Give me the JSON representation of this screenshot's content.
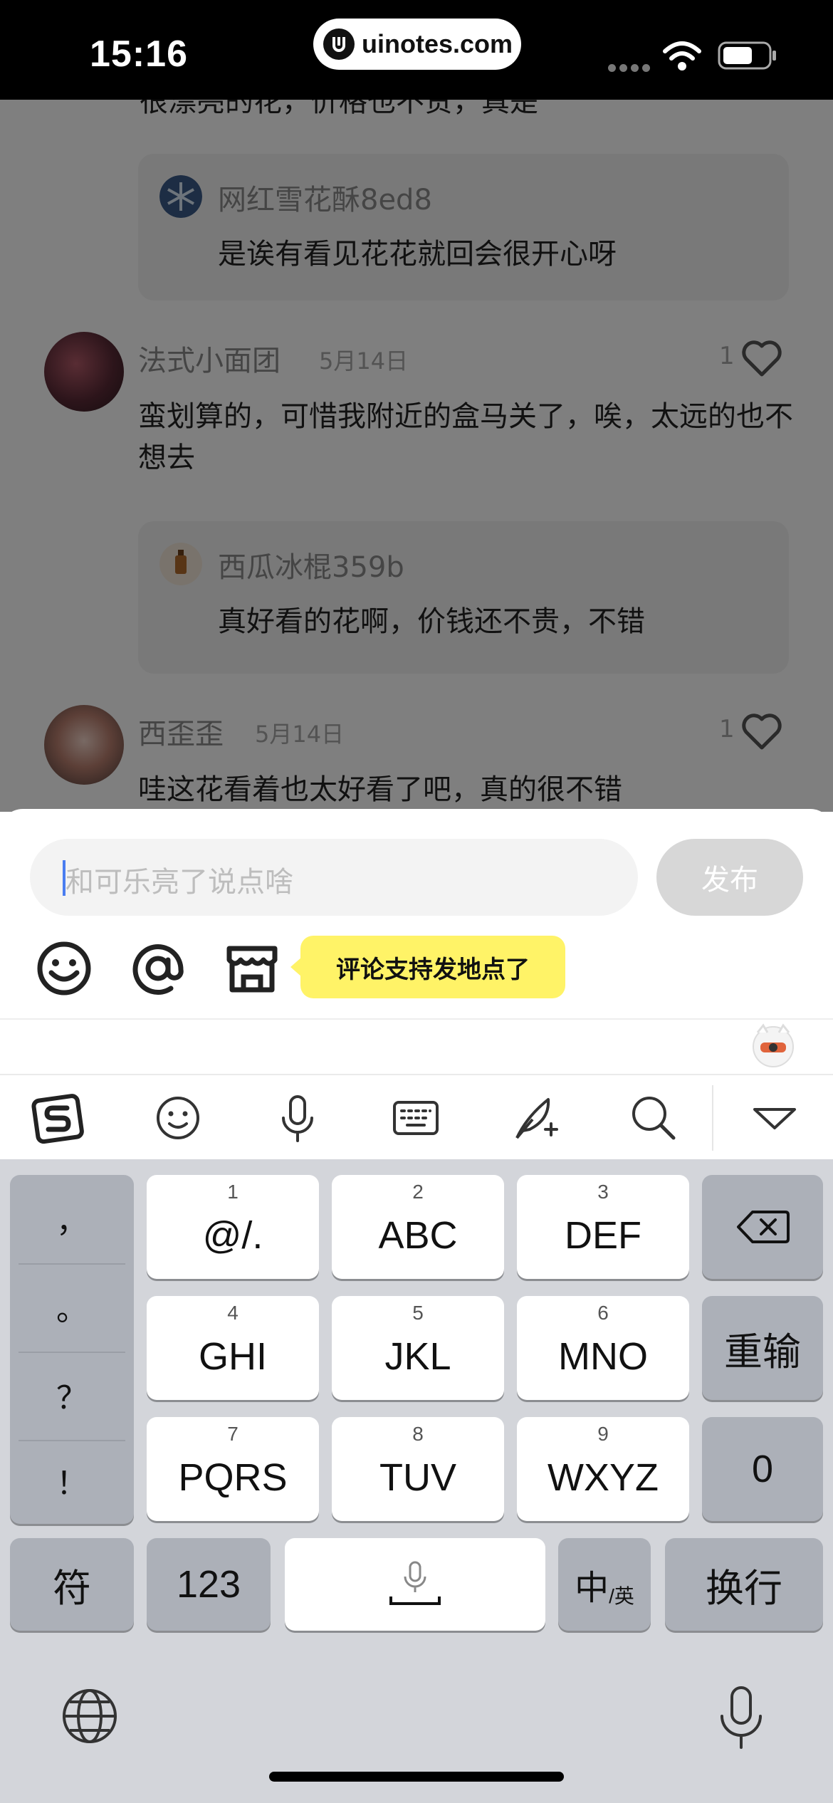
{
  "status_bar": {
    "time": "15:16",
    "url": "uinotes.com"
  },
  "feed": {
    "partial_top_text": "很漂亮的花，价格也不贵，真是",
    "replies": [
      {
        "user": "网红雪花酥8ed8",
        "text": "是诶有看见花花就回会很开心呀"
      },
      {
        "user": "西瓜冰棍359b",
        "text": "真好看的花啊，价钱还不贵，不错"
      }
    ],
    "comments": [
      {
        "user": "法式小面团",
        "date": "5月14日",
        "likes": "1",
        "text": "蛮划算的，可惜我附近的盒马关了，唉，太远的也不想去"
      },
      {
        "user": "西歪歪",
        "date": "5月14日",
        "likes": "1",
        "text": "哇这花看着也太好看了吧，真的很不错"
      }
    ]
  },
  "composer": {
    "placeholder": "和可乐亮了说点啥",
    "publish_label": "发布",
    "tooltip": "评论支持发地点了"
  },
  "keyboard": {
    "punctuation": [
      "，",
      "。",
      "？",
      "！"
    ],
    "keys": [
      {
        "num": "1",
        "label": "@/."
      },
      {
        "num": "2",
        "label": "ABC"
      },
      {
        "num": "3",
        "label": "DEF"
      },
      {
        "num": "4",
        "label": "GHI"
      },
      {
        "num": "5",
        "label": "JKL"
      },
      {
        "num": "6",
        "label": "MNO"
      },
      {
        "num": "7",
        "label": "PQRS"
      },
      {
        "num": "8",
        "label": "TUV"
      },
      {
        "num": "9",
        "label": "WXYZ"
      }
    ],
    "reinput_label": "重输",
    "zero_label": "0",
    "symbol_label": "符",
    "numeric_label": "123",
    "lang_main": "中",
    "lang_sub": "/英",
    "return_label": "换行"
  },
  "colors": {
    "tooltip_bg": "#fff367",
    "caret": "#4a7df0",
    "keyboard_bg": "#d3d5da"
  }
}
